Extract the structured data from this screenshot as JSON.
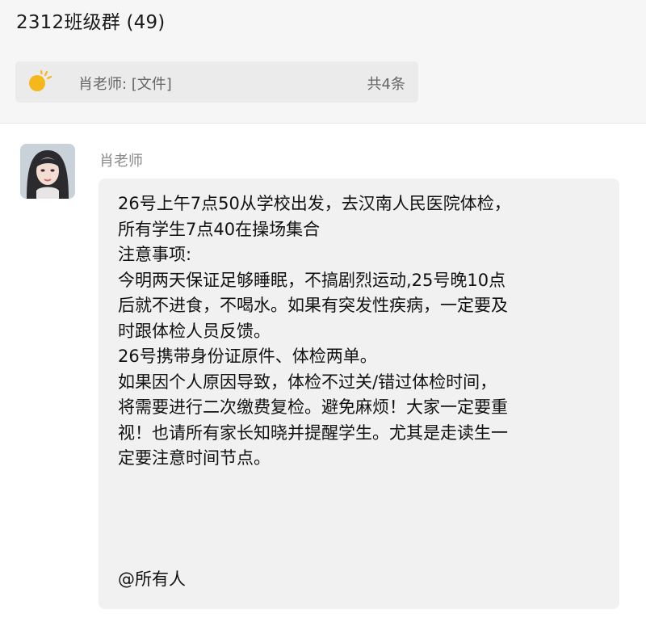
{
  "header": {
    "title": "2312班级群 (49)"
  },
  "pinned_notice": {
    "icon": "sun-icon",
    "sender_text": "肖老师: [文件]",
    "count_text": "共4条"
  },
  "message": {
    "sender": "肖老师",
    "avatar_icon": "avatar-portrait",
    "lines": [
      "26号上午7点50从学校出发，去汉南人民医院体检，",
      "所有学生7点40在操场集合",
      "注意事项:",
      "今明两天保证足够睡眠，不搞剧烈运动,25号晚10点",
      "后就不进食，不喝水。如果有突发性疾病，一定要及",
      "时跟体检人员反馈。",
      "26号携带身份证原件、体检两单。",
      "如果因个人原因导致，体检不过关/错过体检时间，",
      "将需要进行二次缴费复检。避免麻烦！大家一定要重",
      "视！也请所有家长知晓并提醒学生。尤其是走读生一",
      "定要注意时间节点。"
    ],
    "mention": "@所有人"
  },
  "colors": {
    "header_bg": "#f6f6f6",
    "notice_bg": "#ebebeb",
    "bubble_bg": "#f1f1f1",
    "sun": "#f5b81c"
  }
}
